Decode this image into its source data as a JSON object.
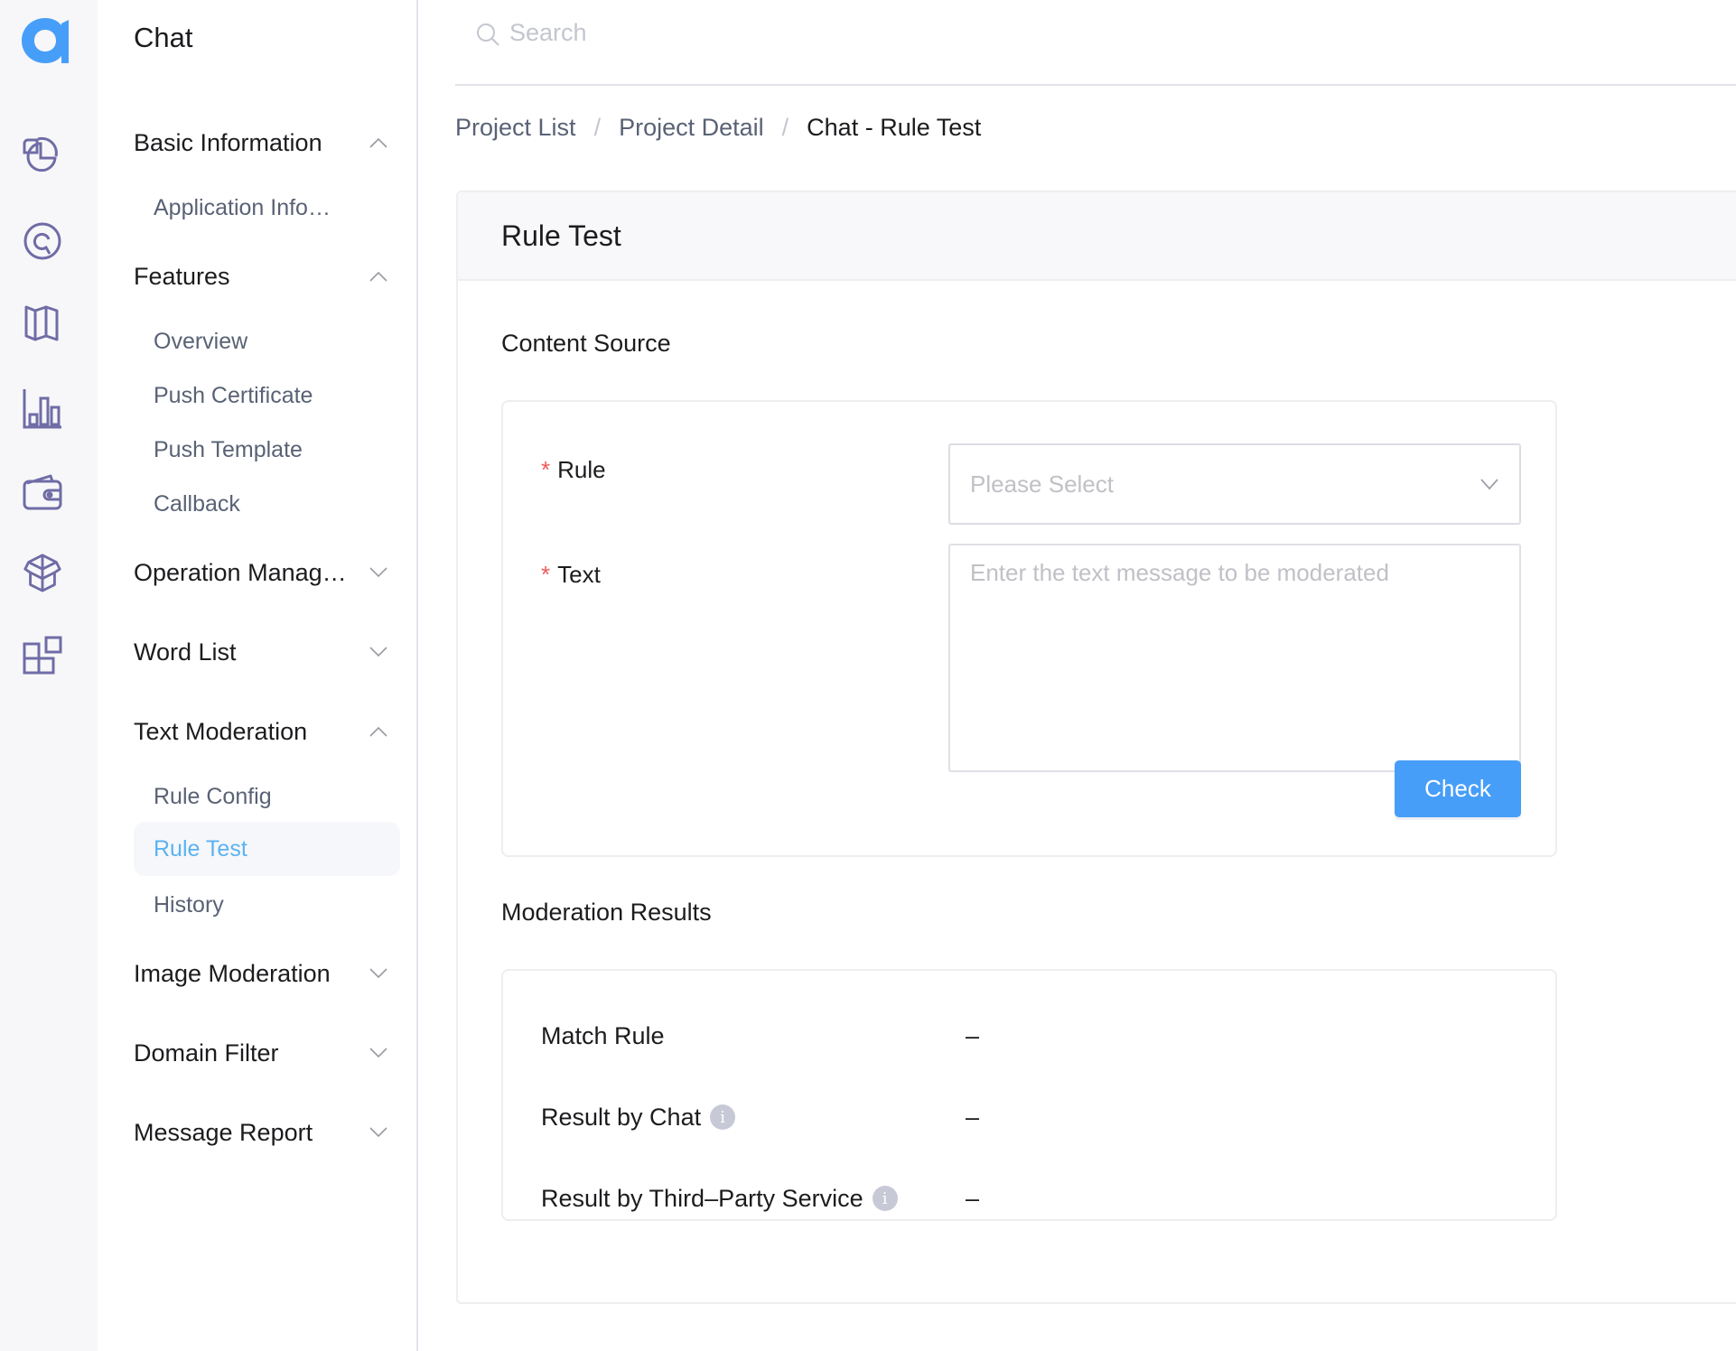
{
  "app": {
    "logo_color": "#479ef8",
    "title": "Chat"
  },
  "rail": {
    "icons": [
      {
        "name": "dashboard-pie-icon"
      },
      {
        "name": "at-sign-icon"
      },
      {
        "name": "map-icon"
      },
      {
        "name": "bar-chart-icon"
      },
      {
        "name": "wallet-icon"
      },
      {
        "name": "package-icon"
      },
      {
        "name": "apps-grid-icon"
      }
    ],
    "icon_color": "#6f6ca6"
  },
  "sidebar": {
    "groups": [
      {
        "label": "Basic Information",
        "expanded": true,
        "items": [
          "Application Info…"
        ]
      },
      {
        "label": "Features",
        "expanded": true,
        "items": [
          "Overview",
          "Push Certificate",
          "Push Template",
          "Callback"
        ]
      },
      {
        "label": "Operation Manag…",
        "expanded": false,
        "items": []
      },
      {
        "label": "Word List",
        "expanded": false,
        "items": []
      },
      {
        "label": "Text Moderation",
        "expanded": true,
        "items": [
          "Rule Config",
          "Rule Test",
          "History"
        ]
      },
      {
        "label": "Image Moderation",
        "expanded": false,
        "items": []
      },
      {
        "label": "Domain Filter",
        "expanded": false,
        "items": []
      },
      {
        "label": "Message Report",
        "expanded": false,
        "items": []
      }
    ],
    "active_item": "Rule Test",
    "active_color": "#5ab2f2"
  },
  "search": {
    "placeholder": "Search",
    "value": ""
  },
  "breadcrumb": {
    "items": [
      "Project List",
      "Project Detail",
      "Chat - Rule Test"
    ],
    "separator": "/"
  },
  "card": {
    "title": "Rule Test",
    "content_source": {
      "heading": "Content Source",
      "rule_label": "Rule",
      "rule_placeholder": "Please Select",
      "rule_value": "",
      "text_label": "Text",
      "text_placeholder": "Enter the text message to be moderated",
      "text_value": "",
      "required_mark": "*",
      "check_button": "Check",
      "button_color": "#479ef8"
    },
    "results": {
      "heading": "Moderation Results",
      "rows": [
        {
          "label": "Match Rule",
          "info": false,
          "value": "–"
        },
        {
          "label": "Result by Chat",
          "info": true,
          "value": "–"
        },
        {
          "label": "Result by Third–Party Service",
          "info": true,
          "value": "–"
        }
      ],
      "info_glyph": "i"
    }
  }
}
